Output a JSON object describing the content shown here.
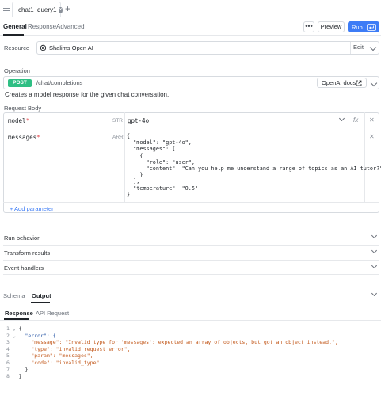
{
  "tab": {
    "title": "chat1_query1"
  },
  "subtabs": [
    "General",
    "Response",
    "Advanced"
  ],
  "toolbar": {
    "more": "•••",
    "preview": "Preview",
    "run": "Run"
  },
  "resource": {
    "label": "Resource",
    "name": "Shalims Open AI",
    "action": "Edit"
  },
  "operation": {
    "label": "Operation",
    "method": "POST",
    "path": "/chat/completions",
    "docs": "OpenAI docs",
    "description": "Creates a model response for the given chat conversation."
  },
  "request_body": {
    "label": "Request Body",
    "params": [
      {
        "name": "model",
        "type": "STR",
        "value": "gpt-4o"
      },
      {
        "name": "messages",
        "type": "ARR"
      }
    ],
    "messages_code": "{\n  \"model\": \"gpt-4o\",\n  \"messages\": [\n    {\n      \"role\": \"user\",\n      \"content\": \"Can you help me understand a range of topics as an AI tutor?\"\n    }\n  ],\n  \"temperature\": \"0.5\"\n}",
    "fx": "fx",
    "add_param": "+ Add parameter"
  },
  "sections": [
    "Run behavior",
    "Transform results",
    "Event handlers"
  ],
  "bottom": {
    "tabs": [
      "Schema",
      "Output"
    ],
    "response_tabs": [
      "Response",
      "API Request"
    ],
    "lines": [
      {
        "n": "1",
        "fold": "⌄",
        "text": "{"
      },
      {
        "n": "2",
        "fold": "⌄",
        "text": "  \"error\": {"
      },
      {
        "n": "3",
        "fold": "",
        "text": "    \"message\": \"Invalid type for 'messages': expected an array of objects, but got an object instead.\","
      },
      {
        "n": "4",
        "fold": "",
        "text": "    \"type\": \"invalid_request_error\","
      },
      {
        "n": "5",
        "fold": "",
        "text": "    \"param\": \"messages\","
      },
      {
        "n": "6",
        "fold": "",
        "text": "    \"code\": \"invalid_type\""
      },
      {
        "n": "7",
        "fold": "",
        "text": "  }"
      },
      {
        "n": "8",
        "fold": "",
        "text": "}"
      }
    ]
  },
  "colors": {
    "run": "#3d7cf6",
    "post": "#2fbf84",
    "required": "#e5484d"
  }
}
